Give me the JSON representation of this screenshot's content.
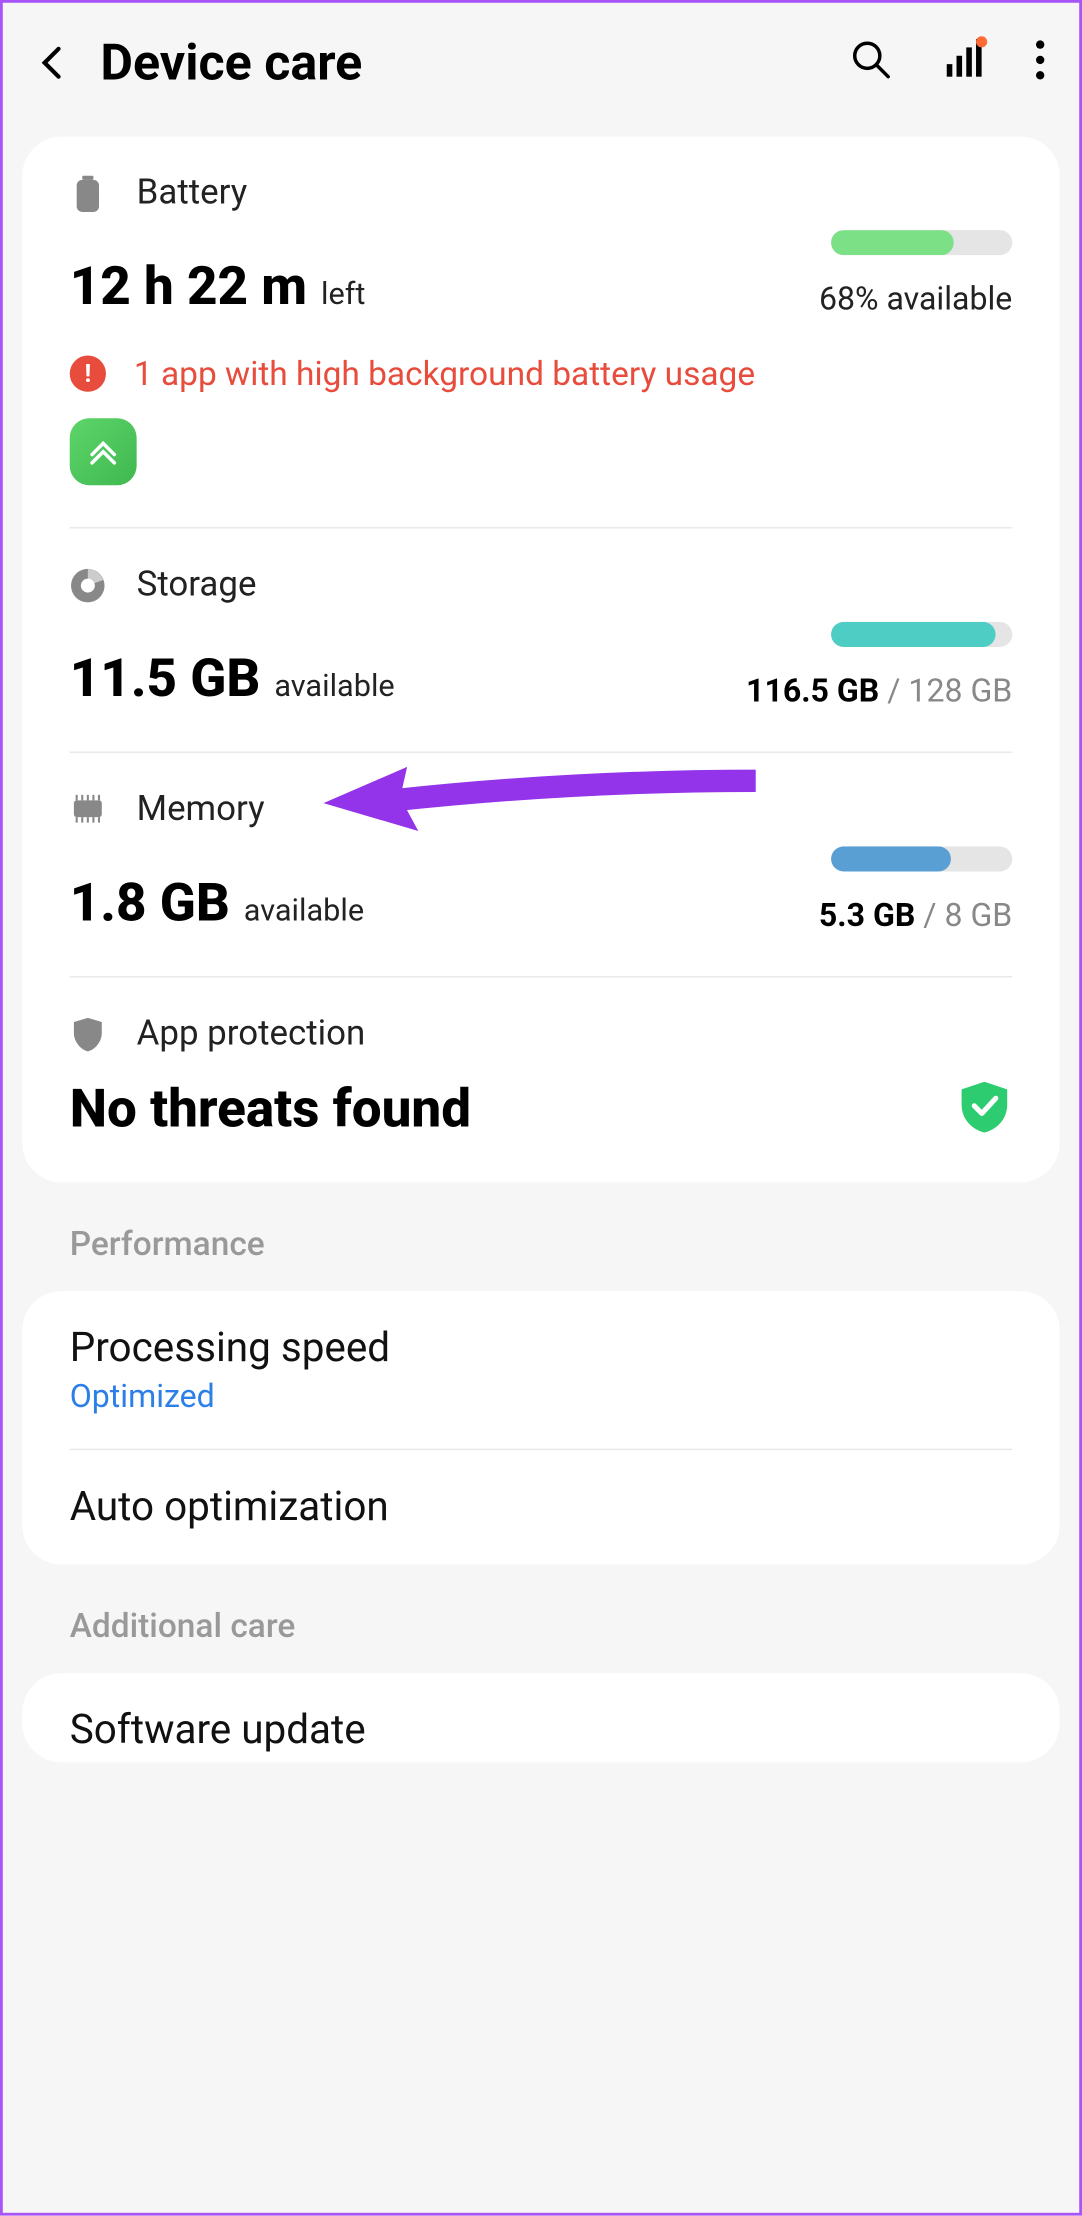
{
  "header": {
    "title": "Device care"
  },
  "battery": {
    "label": "Battery",
    "value": "12 h 22 m",
    "suffix": "left",
    "available": "68% available",
    "warning": "1 app with high background battery usage",
    "progress": 68
  },
  "storage": {
    "label": "Storage",
    "value": "11.5 GB",
    "suffix": "available",
    "used": "116.5 GB",
    "total": "/ 128 GB",
    "progress": 91
  },
  "memory": {
    "label": "Memory",
    "value": "1.8 GB",
    "suffix": "available",
    "used": "5.3 GB",
    "total": "/ 8 GB",
    "progress": 66
  },
  "protection": {
    "label": "App protection",
    "status": "No threats found"
  },
  "groups": {
    "performance": "Performance",
    "additional": "Additional care"
  },
  "items": {
    "processing": {
      "title": "Processing speed",
      "sub": "Optimized"
    },
    "auto": {
      "title": "Auto optimization"
    },
    "software": {
      "title": "Software update"
    }
  }
}
